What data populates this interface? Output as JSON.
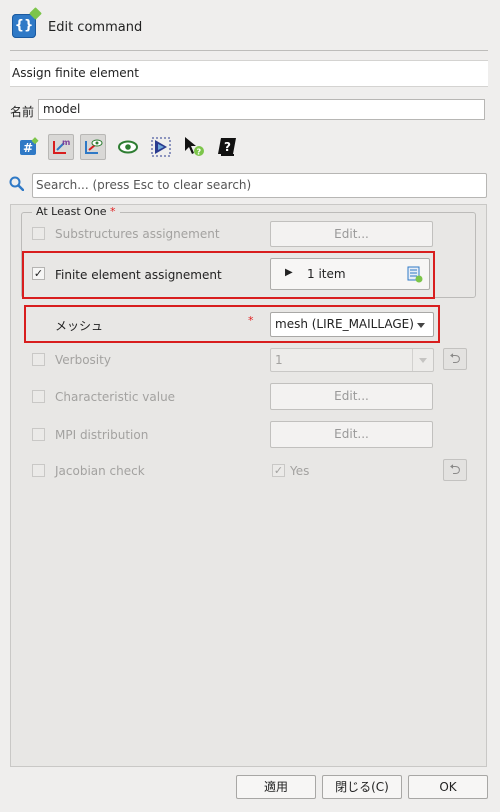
{
  "window": {
    "title": "Edit command"
  },
  "command": {
    "name": "Assign finite element"
  },
  "name_field": {
    "label": "名前",
    "value": "model"
  },
  "toolbar": {
    "icons": [
      "hash-edit-icon",
      "graph-m-icon",
      "graph-eye-icon",
      "eye-icon",
      "cut-shape-icon",
      "pointer-help-icon",
      "help-book-icon"
    ]
  },
  "search": {
    "placeholder": "Search... (press Esc to clear search)"
  },
  "group": {
    "label": "At Least One",
    "required_mark": "*"
  },
  "rows": {
    "substructures": {
      "label": "Substructures assignement",
      "button": "Edit..."
    },
    "finite_element": {
      "label": "Finite element assignement",
      "value": "1 item"
    },
    "mesh": {
      "label": "メッシュ",
      "required_mark": "*",
      "value": "mesh (LIRE_MAILLAGE)"
    },
    "verbosity": {
      "label": "Verbosity",
      "value": "1"
    },
    "characteristic": {
      "label": "Characteristic value",
      "button": "Edit..."
    },
    "mpi": {
      "label": "MPI distribution",
      "button": "Edit..."
    },
    "jacobian": {
      "label": "Jacobian check",
      "value": "Yes"
    }
  },
  "footer": {
    "apply": "適用",
    "close": "閉じる(C)",
    "ok": "OK"
  },
  "colors": {
    "accent_blue": "#2f79c6",
    "highlight_red": "#d81e1e",
    "required_red": "#e02020"
  }
}
